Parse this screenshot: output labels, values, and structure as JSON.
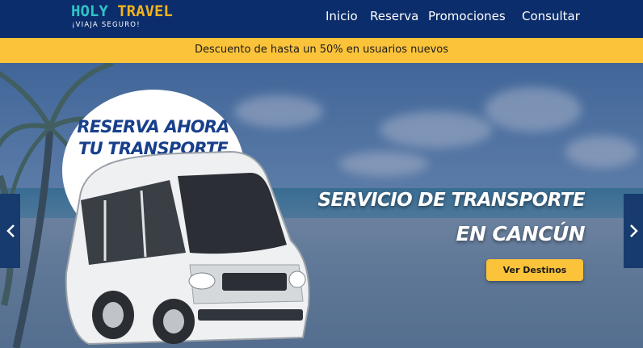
{
  "header": {
    "logo": {
      "brand_word1": "HOLY",
      "brand_word2": "TRAVEL",
      "tagline": "¡VIAJA SEGURO!"
    },
    "nav": [
      "Inicio",
      "Reserva",
      "Promociones",
      "Consultar"
    ]
  },
  "promo": {
    "text": "Descuento de hasta un 50% en usuarios nuevos"
  },
  "hero": {
    "bubble_line1": "RESERVA AHORA",
    "bubble_line2": "TU TRANSPORTE",
    "headline_line1": "SERVICIO DE TRANSPORTE",
    "headline_line2": "EN CANCÚN",
    "cta_label": "Ver Destinos",
    "prev_icon": "chevron-left-icon",
    "next_icon": "chevron-right-icon"
  },
  "colors": {
    "header_bg": "#0b2d6b",
    "accent_yellow": "#fbc33a",
    "logo_teal": "#2fc3c6",
    "logo_gold": "#f2b21d",
    "bubble_text": "#183f8c"
  }
}
